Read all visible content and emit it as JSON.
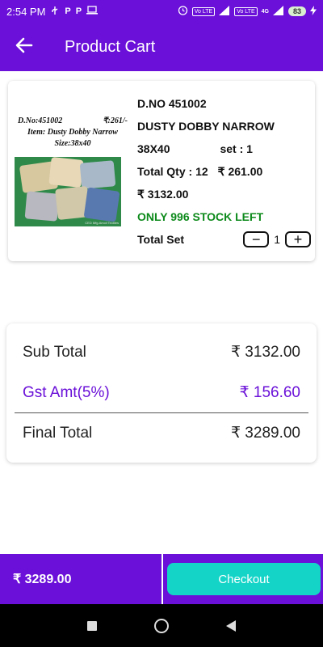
{
  "status_bar": {
    "time": "2:54 PM",
    "left_icons": [
      "usb-icon",
      "parking-app-icon",
      "parking-app-icon",
      "laptop-icon"
    ],
    "right_icons": [
      "alarm-icon",
      "volte-icon",
      "signal-icon",
      "volte-icon",
      "signal-icon"
    ],
    "volte_label": "Vo LTE",
    "network_label": "4G",
    "battery": "83"
  },
  "app_bar": {
    "title": "Product Cart",
    "back_icon": "arrow-left-icon"
  },
  "cart_item": {
    "thumbnail": {
      "dno": "D.No:451002",
      "price": "₹:261/-",
      "item": "Item: Dusty Dobby Narrow",
      "size": "Size:38x40",
      "watermark": "CED Mfg.Amoli Textiles"
    },
    "dno": "D.NO 451002",
    "name": "DUSTY DOBBY NARROW",
    "size": "38X40",
    "set": "set : 1",
    "total_qty": "Total Qty :  12",
    "unit_price": "₹ 261.00",
    "amount": "₹ 3132.00",
    "stock": "ONLY 996 STOCK LEFT",
    "total_set_label": "Total Set",
    "quantity": "1",
    "minus_label": "−",
    "plus_label": "+"
  },
  "summary": {
    "sub_total_label": "Sub Total",
    "sub_total_value": "₹ 3132.00",
    "gst_label": "Gst Amt(5%)",
    "gst_value": "₹ 156.60",
    "final_total_label": "Final Total",
    "final_total_value": "₹ 3289.00"
  },
  "bottom_bar": {
    "total": "₹ 3289.00",
    "checkout_label": "Checkout"
  },
  "colors": {
    "primary": "#6a10d8",
    "accent": "#14d4c8",
    "stock_green": "#0d8a1b"
  }
}
